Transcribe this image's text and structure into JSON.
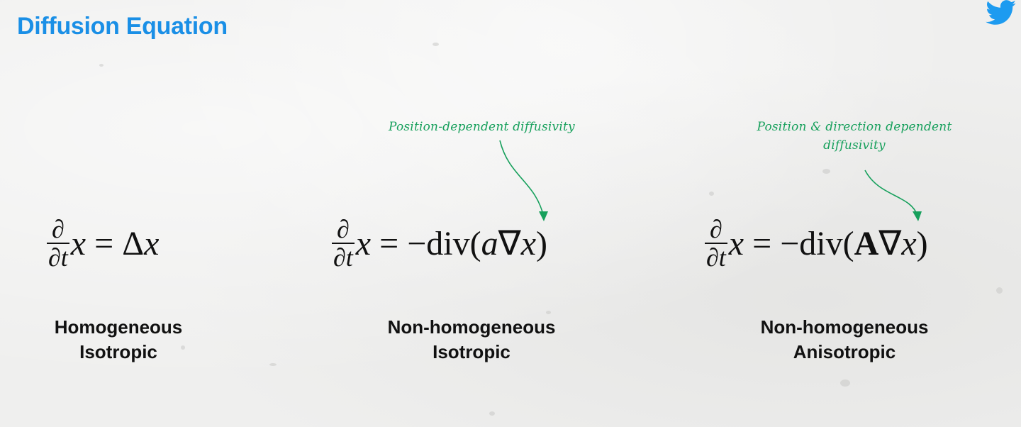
{
  "header": {
    "title": "Diffusion Equation",
    "twitter_icon": "twitter-bird-icon",
    "title_color": "#1a8fe6"
  },
  "annotation_color": "#17a05c",
  "equations": [
    {
      "derivative_num": "∂",
      "derivative_den": "∂t",
      "lhs_var": "x",
      "eq_sign": " = ",
      "rhs_pre": "Δ",
      "rhs_var": "x",
      "label_line1": "Homogeneous",
      "label_line2": "Isotropic"
    },
    {
      "derivative_num": "∂",
      "derivative_den": "∂t",
      "lhs_var": "x",
      "eq_sign": " = ",
      "rhs_pre": "−div(",
      "rhs_coef": "a",
      "rhs_nabla": "∇",
      "rhs_var": "x",
      "rhs_close": ")",
      "annotation": "Position-dependent diffusivity",
      "label_line1": "Non-homogeneous",
      "label_line2": "Isotropic"
    },
    {
      "derivative_num": "∂",
      "derivative_den": "∂t",
      "lhs_var": "x",
      "eq_sign": " = ",
      "rhs_pre": "−div(",
      "rhs_coef": "A",
      "rhs_nabla": "∇",
      "rhs_var": "x",
      "rhs_close": ")",
      "annotation_line1": "Position & direction dependent",
      "annotation_line2": "diffusivity",
      "label_line1": "Non-homogeneous",
      "label_line2": "Anisotropic"
    }
  ]
}
